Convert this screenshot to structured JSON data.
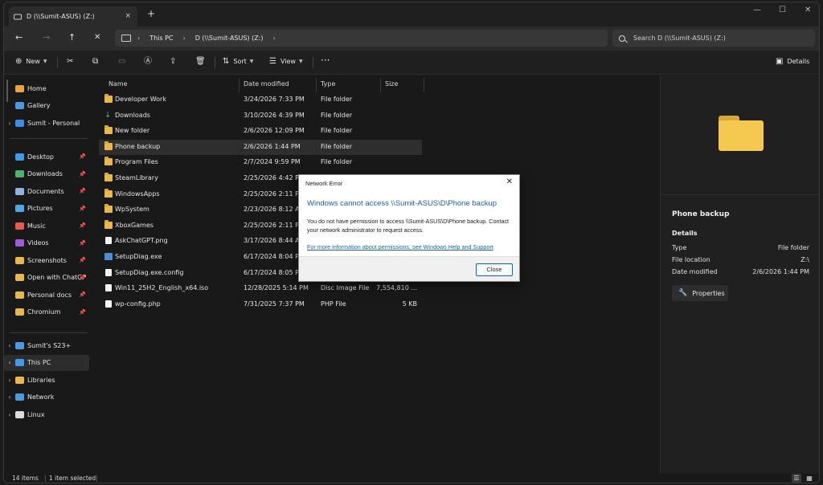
{
  "tab": {
    "title": "D (\\\\Sumit-ASUS) (Z:)",
    "close": "×",
    "new": "+"
  },
  "window_controls": {
    "minimize": "—",
    "maximize": "☐",
    "close": "✕"
  },
  "nav": {
    "back": "←",
    "forward": "→",
    "up": "↑",
    "stop": "✕"
  },
  "address": {
    "crumbs": [
      "This PC",
      "D (\\\\Sumit-ASUS) (Z:)"
    ],
    "separator": "›"
  },
  "search": {
    "placeholder": "Search D (\\\\Sumit-ASUS) (Z:)"
  },
  "toolbar": {
    "new": "New",
    "sort": "Sort",
    "view": "View",
    "more": "···",
    "details": "Details",
    "icons": {
      "new": "⊕",
      "cut": "✂",
      "copy": "⧉",
      "paste": "▭",
      "rename": "Ⓐ",
      "share": "⇪",
      "delete": "🗑",
      "sort": "⇅",
      "view": "☰",
      "details": "▣"
    }
  },
  "sidebar": {
    "quick": [
      {
        "label": "Home",
        "color": "#e8a33d"
      },
      {
        "label": "Gallery",
        "color": "#4a9be0"
      },
      {
        "label": "Sumit - Personal",
        "color": "#3a8ee6"
      }
    ],
    "pinned": [
      {
        "label": "Desktop",
        "color": "#3d9be9"
      },
      {
        "label": "Downloads",
        "color": "#4fb36b"
      },
      {
        "label": "Documents",
        "color": "#8fb4e3"
      },
      {
        "label": "Pictures",
        "color": "#4fa8e8"
      },
      {
        "label": "Music",
        "color": "#e85a4f"
      },
      {
        "label": "Videos",
        "color": "#a259d9"
      },
      {
        "label": "Screenshots",
        "color": "#e8b84a"
      },
      {
        "label": "Open with ChatGP",
        "color": "#e8b84a"
      },
      {
        "label": "Personal docs",
        "color": "#e8b84a"
      },
      {
        "label": "Chromium",
        "color": "#e8b84a"
      }
    ],
    "pin_icon": "📌",
    "devices": [
      {
        "label": "Sumit's S23+",
        "color": "#4a9be0"
      },
      {
        "label": "This PC",
        "color": "#3d9be9"
      },
      {
        "label": "Libraries",
        "color": "#e8b84a"
      },
      {
        "label": "Network",
        "color": "#4a9be0"
      },
      {
        "label": "Linux",
        "color": "#dcdcdc"
      }
    ],
    "expander": "›"
  },
  "columns": {
    "name": "Name",
    "date": "Date modified",
    "type": "Type",
    "size": "Size"
  },
  "files": [
    {
      "name": "Developer Work",
      "date": "3/24/2026 7:33 PM",
      "type": "File folder",
      "size": "",
      "kind": "folder"
    },
    {
      "name": "Downloads",
      "date": "3/10/2026 4:39 PM",
      "type": "File folder",
      "size": "",
      "kind": "download"
    },
    {
      "name": "New folder",
      "date": "2/6/2026 12:09 PM",
      "type": "File folder",
      "size": "",
      "kind": "folder"
    },
    {
      "name": "Phone backup",
      "date": "2/6/2026 1:44 PM",
      "type": "File folder",
      "size": "",
      "kind": "folder",
      "selected": true
    },
    {
      "name": "Program Files",
      "date": "2/7/2024 9:59 PM",
      "type": "File folder",
      "size": "",
      "kind": "folder"
    },
    {
      "name": "SteamLibrary",
      "date": "2/25/2026 4:42 PM",
      "type": "",
      "size": "",
      "kind": "folder"
    },
    {
      "name": "WindowsApps",
      "date": "2/25/2026 2:11 PM",
      "type": "",
      "size": "",
      "kind": "folder"
    },
    {
      "name": "WpSystem",
      "date": "2/23/2026 8:12 AM",
      "type": "",
      "size": "",
      "kind": "folder"
    },
    {
      "name": "XboxGames",
      "date": "2/25/2026 2:11 PM",
      "type": "",
      "size": "",
      "kind": "folder"
    },
    {
      "name": "AskChatGPT.png",
      "date": "3/17/2026 8:44 AM",
      "type": "",
      "size": "",
      "kind": "file"
    },
    {
      "name": "SetupDiag.exe",
      "date": "6/17/2024 8:04 PM",
      "type": "",
      "size": "",
      "kind": "exe"
    },
    {
      "name": "SetupDiag.exe.config",
      "date": "6/17/2024 8:05 PM",
      "type": "",
      "size": "",
      "kind": "file"
    },
    {
      "name": "Win11_25H2_English_x64.iso",
      "date": "12/28/2025 5:14 PM",
      "type": "Disc Image File",
      "size": "7,554,810 ...",
      "kind": "file"
    },
    {
      "name": "wp-config.php",
      "date": "7/31/2025 7:37 PM",
      "type": "PHP File",
      "size": "5 KB",
      "kind": "file"
    }
  ],
  "details_pane": {
    "title": "Phone backup",
    "section": "Details",
    "rows": [
      {
        "label": "Type",
        "value": "File folder"
      },
      {
        "label": "File location",
        "value": "Z:\\"
      },
      {
        "label": "Date modified",
        "value": "2/6/2026 1:44 PM"
      }
    ],
    "properties_button": "Properties",
    "properties_icon": "🔧"
  },
  "status": {
    "items": "14 items",
    "selected": "1 item selected"
  },
  "dialog": {
    "title": "Network Error",
    "close": "✕",
    "heading": "Windows cannot access \\\\Sumit-ASUS\\D\\Phone backup",
    "body": "You do not have permission to access \\\\Sumit-ASUS\\D\\Phone backup. Contact your network administrator to request access.",
    "link": "For more information about permissions, see Windows Help and Support",
    "button": "Close"
  }
}
